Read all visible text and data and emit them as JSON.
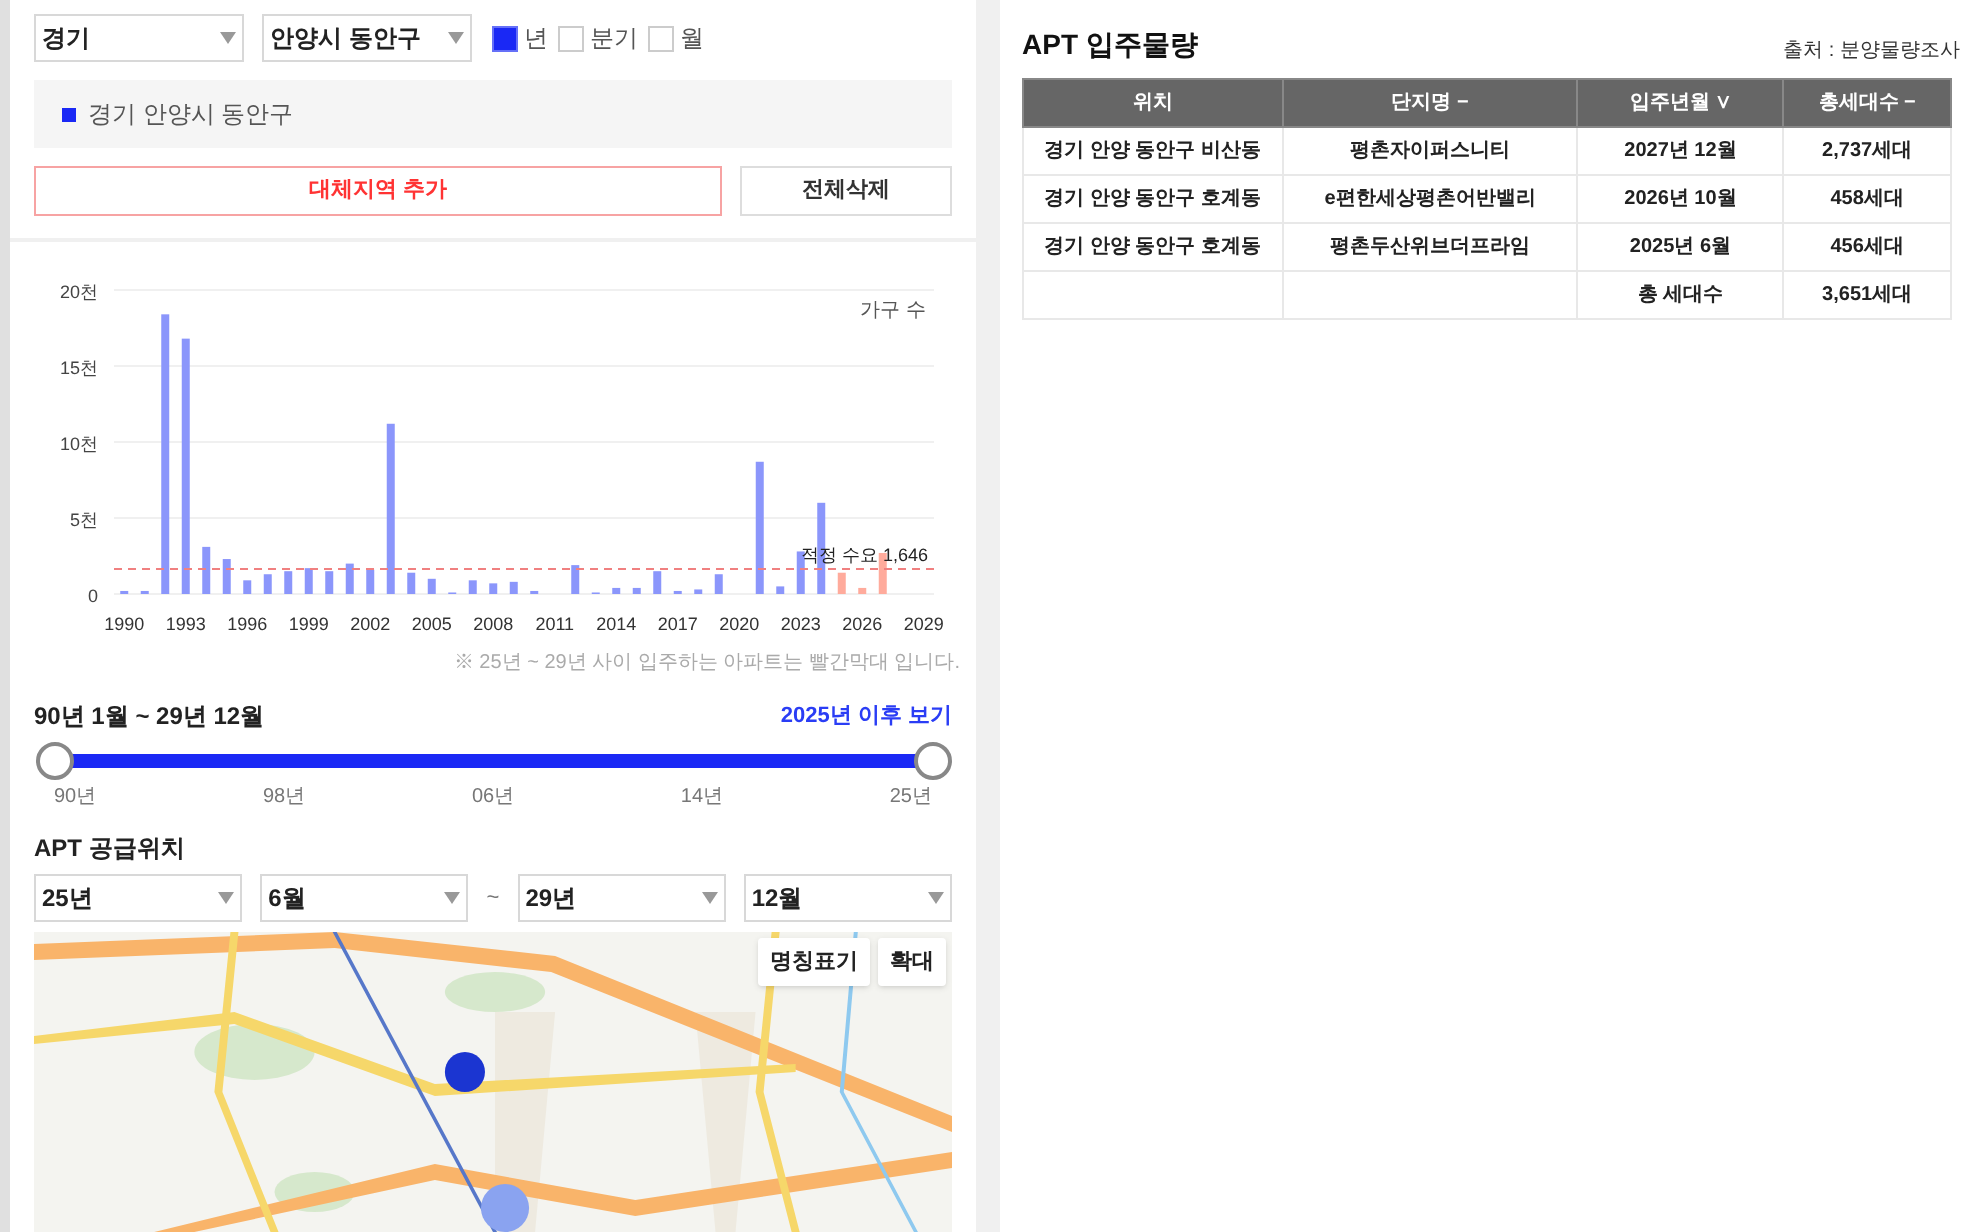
{
  "filters": {
    "region": "경기",
    "district": "안양시 동안구",
    "periods": [
      {
        "label": "년",
        "checked": true
      },
      {
        "label": "분기",
        "checked": false
      },
      {
        "label": "월",
        "checked": false
      }
    ]
  },
  "legend": [
    {
      "label": "경기 안양시 동안구",
      "color": "#1a28f5"
    }
  ],
  "buttons": {
    "add": "대체지역 추가",
    "clear": "전체삭제"
  },
  "chart": {
    "chart_data": {
      "type": "bar",
      "ylabel": "가구 수",
      "x": [
        1990,
        1991,
        1992,
        1993,
        1994,
        1995,
        1996,
        1997,
        1998,
        1999,
        2000,
        2001,
        2002,
        2003,
        2004,
        2005,
        2006,
        2007,
        2008,
        2009,
        2010,
        2011,
        2012,
        2013,
        2014,
        2015,
        2016,
        2017,
        2018,
        2019,
        2020,
        2021,
        2022,
        2023,
        2024,
        2025,
        2026,
        2027,
        2028,
        2029
      ],
      "series": [
        {
          "color": "#8b96fb",
          "values": [
            0.2,
            0.2,
            18.4,
            16.8,
            3.1,
            2.3,
            0.9,
            1.3,
            1.5,
            1.7,
            1.5,
            2.0,
            1.6,
            11.2,
            1.4,
            1.0,
            0.1,
            0.9,
            0.7,
            0.8,
            0.2,
            0,
            1.9,
            0.1,
            0.4,
            0.4,
            1.5,
            0.2,
            0.3,
            1.3,
            0,
            8.7,
            0.5,
            2.8,
            6.0,
            null,
            null,
            null,
            null,
            null
          ]
        },
        {
          "color": "#ffab9c",
          "values": [
            null,
            null,
            null,
            null,
            null,
            null,
            null,
            null,
            null,
            null,
            null,
            null,
            null,
            null,
            null,
            null,
            null,
            null,
            null,
            null,
            null,
            null,
            null,
            null,
            null,
            null,
            null,
            null,
            null,
            null,
            null,
            null,
            null,
            null,
            null,
            1.4,
            0.4,
            2.7,
            0,
            0
          ]
        }
      ],
      "ylim": [
        0,
        20
      ],
      "yticks": [
        {
          "value": 0,
          "label": "0"
        },
        {
          "value": 5,
          "label": "5천"
        },
        {
          "value": 10,
          "label": "10천"
        },
        {
          "value": 15,
          "label": "15천"
        },
        {
          "value": 20,
          "label": "20천"
        }
      ],
      "xlim": [
        1989.5,
        2029.5
      ],
      "xticks": [
        1990,
        1993,
        1996,
        1999,
        2002,
        2005,
        2008,
        2011,
        2014,
        2017,
        2020,
        2023,
        2026,
        2029
      ],
      "grid": true,
      "ref_lines": [
        {
          "axis": "y",
          "value": 1.646,
          "label": "적정 수요 1,646",
          "color": "#f08080"
        }
      ]
    },
    "note": "※ 25년 ~ 29년 사이 입주하는 아파트는 빨간막대 입니다."
  },
  "range": {
    "title": "90년 1월 ~ 29년 12월",
    "link": "2025년 이후 보기",
    "handles": [
      {
        "level": 0
      },
      {
        "level": 1
      }
    ],
    "ticks": [
      "90년",
      "98년",
      "06년",
      "14년",
      "25년"
    ]
  },
  "supply": {
    "title": "APT 공급위치",
    "from_year": "25년",
    "from_month": "6월",
    "separator": "~",
    "to_year": "29년",
    "to_month": "12월"
  },
  "map": {
    "kind": "picture",
    "buttons": [
      "명칭표기",
      "확대"
    ]
  },
  "table": {
    "title": "APT 입주물량",
    "source": "출처 : 분양물량조사",
    "columns": [
      {
        "label": "위치"
      },
      {
        "label": "단지명",
        "sort": "−"
      },
      {
        "label": "입주년월",
        "sort": "∨"
      },
      {
        "label": "총세대수",
        "sort": "−"
      }
    ],
    "rows": [
      [
        "경기 안양 동안구 비산동",
        "평촌자이퍼스니티",
        "2027년 12월",
        "2,737세대"
      ],
      [
        "경기 안양 동안구 호계동",
        "e편한세상평촌어반밸리",
        "2026년 10월",
        "458세대"
      ],
      [
        "경기 안양 동안구 호계동",
        "평촌두산위브더프라임",
        "2025년 6월",
        "456세대"
      ],
      [
        "",
        "",
        "총 세대수",
        "3,651세대"
      ]
    ]
  }
}
